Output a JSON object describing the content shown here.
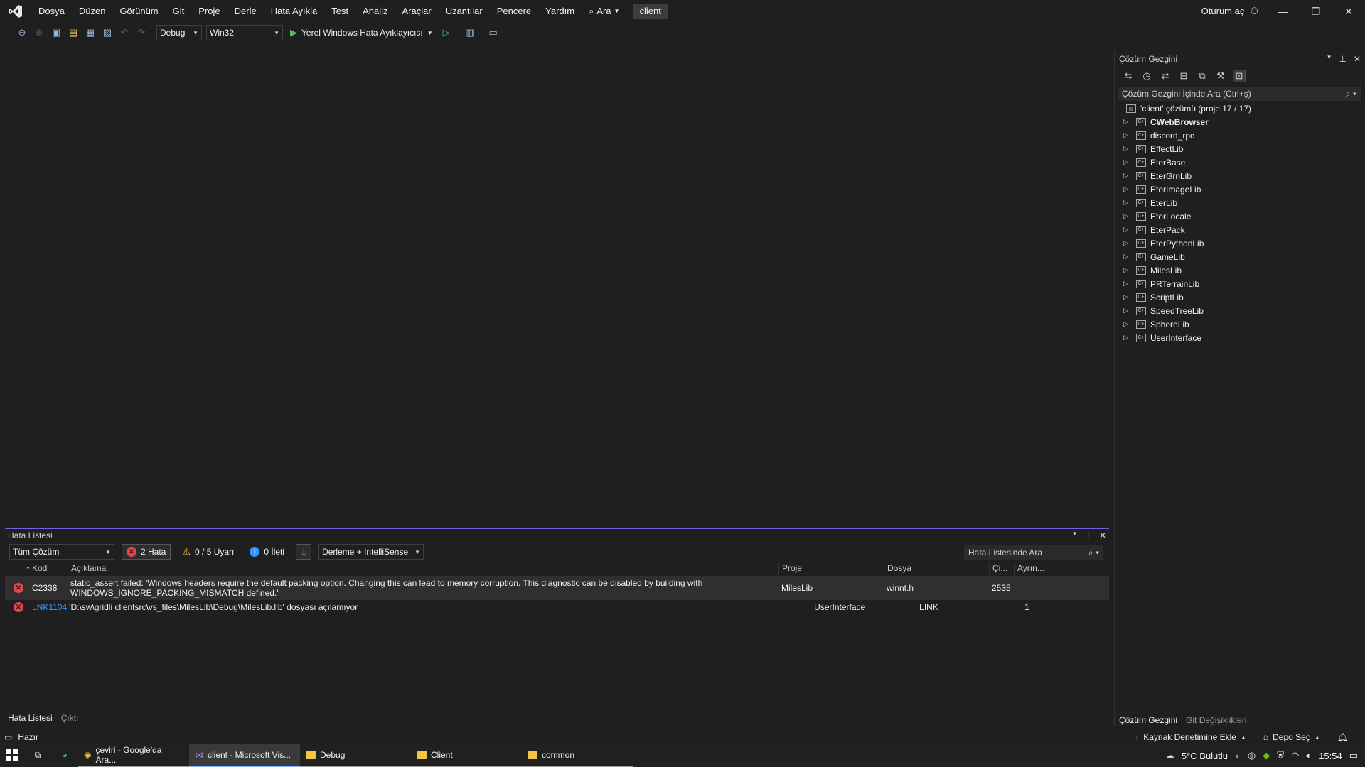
{
  "menu": {
    "items": [
      "Dosya",
      "Düzen",
      "Görünüm",
      "Git",
      "Proje",
      "Derle",
      "Hata Ayıkla",
      "Test",
      "Analiz",
      "Araçlar",
      "Uzantılar",
      "Pencere",
      "Yardım"
    ],
    "search_label": "Ara",
    "solution_name": "client",
    "signin_label": "Oturum aç"
  },
  "toolbar": {
    "config": "Debug",
    "platform": "Win32",
    "run_label": "Yerel Windows Hata Ayıklayıcısı"
  },
  "solution_explorer": {
    "title": "Çözüm Gezgini",
    "search_placeholder": "Çözüm Gezgini İçinde Ara (Ctrl+ş)",
    "root": "'client' çözümü (proje 17 / 17)",
    "projects": [
      "CWebBrowser",
      "discord_rpc",
      "EffectLib",
      "EterBase",
      "EterGrnLib",
      "EterImageLib",
      "EterLib",
      "EterLocale",
      "EterPack",
      "EterPythonLib",
      "GameLib",
      "MilesLib",
      "PRTerrainLib",
      "ScriptLib",
      "SpeedTreeLib",
      "SphereLib",
      "UserInterface"
    ],
    "bold_project": "CWebBrowser",
    "tabs": [
      "Çözüm Gezgini",
      "Git Değişiklikleri"
    ]
  },
  "error_list": {
    "title": "Hata Listesi",
    "scope": "Tüm Çözüm",
    "errors_filter": "2 Hata",
    "warnings_filter": "0 / 5 Uyarı",
    "messages_filter": "0 İleti",
    "build_filter": "Derleme + IntelliSense",
    "search_placeholder": "Hata Listesinde Ara",
    "columns": {
      "code": "Kod",
      "description": "Açıklama",
      "project": "Proje",
      "file": "Dosya",
      "line": "Çi...",
      "suppression": "Ayrın..."
    },
    "rows": [
      {
        "code": "C2338",
        "description_line1": "static_assert failed: 'Windows headers require the default packing option. Changing this can lead to memory corruption. This diagnostic can be disabled by building with",
        "description_line2": "WINDOWS_IGNORE_PACKING_MISMATCH defined.'",
        "project": "MilesLib",
        "file": "winnt.h",
        "line": "2535"
      },
      {
        "code": "LNK1104",
        "description_line1": "'D:\\sw\\gridli clientsrc\\vs_files\\MilesLib\\Debug\\MilesLib.lib' dosyası açılamıyor",
        "project": "UserInterface",
        "file": "LINK",
        "line": "1"
      }
    ],
    "tabs": [
      "Hata Listesi",
      "Çıktı"
    ]
  },
  "statusbar": {
    "ready": "Hazır",
    "source_control": "Kaynak Denetimine Ekle",
    "repo": "Depo Seç"
  },
  "taskbar": {
    "apps": [
      "çeviri - Google'da Ara...",
      "client - Microsoft Vis...",
      "Debug",
      "Client",
      "common"
    ],
    "weather": "5°C  Bulutlu",
    "time": "15:54"
  }
}
